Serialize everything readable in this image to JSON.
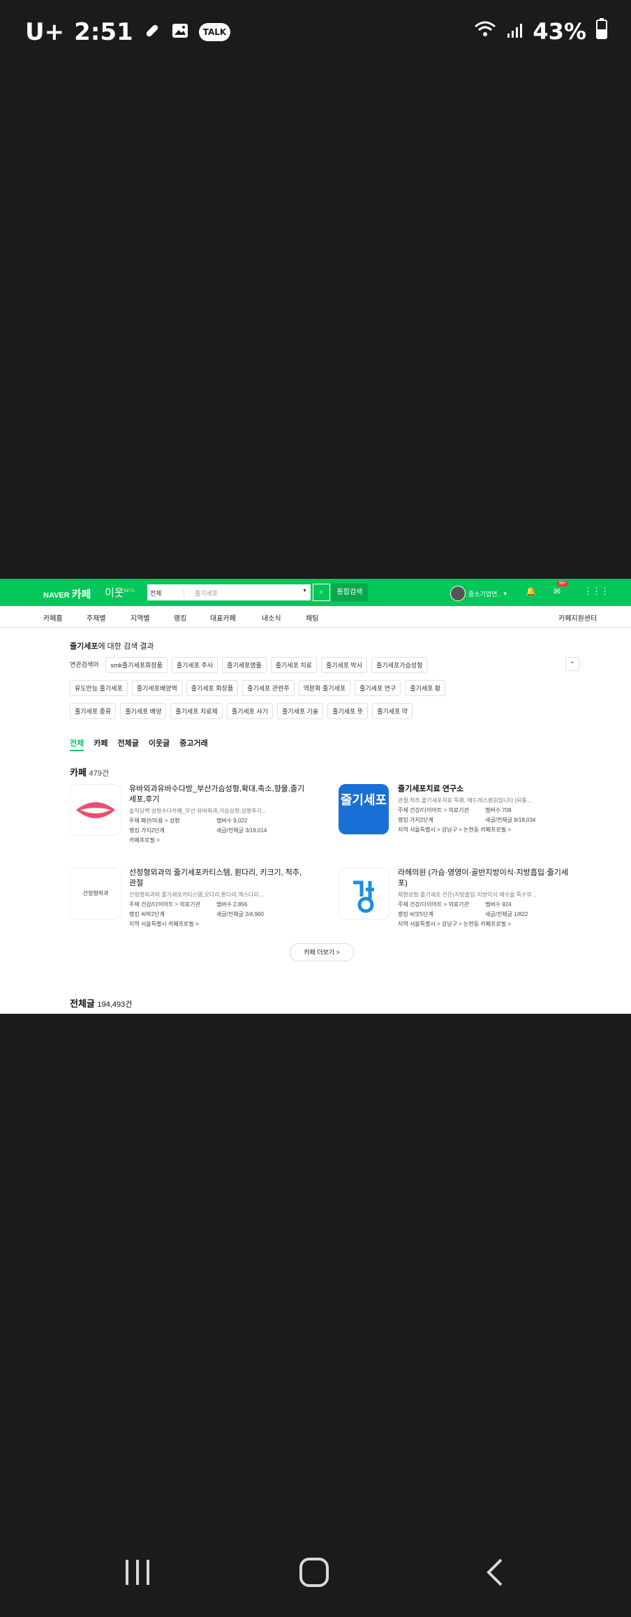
{
  "statusbar": {
    "carrier": "U+",
    "time": "2:51",
    "talk_label": "TALK",
    "battery": "43%"
  },
  "header": {
    "logo_naver": "NAVER",
    "logo_cafe": "카페",
    "iwot": "이웃",
    "iwot_beta": "BETA",
    "search_scope": "전체",
    "search_query": "줄기세포",
    "search_btn": "통합검색",
    "user_name": "중소기업연..",
    "mail_badge": "99+"
  },
  "nav": {
    "items": [
      "카페홈",
      "주제별",
      "지역별",
      "랭킹",
      "대표카페",
      "내소식",
      "채팅"
    ],
    "help": "카페지원센터"
  },
  "results": {
    "keyword": "줄기세포",
    "title_suffix": "에 대한 검색 결과",
    "related_label": "연관검색어",
    "related": [
      "smk줄기세포회장품",
      "줄기세포 주사",
      "줄기세포앰플",
      "줄기세포 치료",
      "줄기세포 박사",
      "줄기세포가슴성형",
      "유도만능 줄기세포",
      "줄기세포배양액",
      "줄기세포 화장품",
      "줄기세포 관련주",
      "역분화 줄기세포",
      "줄기세포 연구",
      "줄기세포 황",
      "줄기세포 종류",
      "줄기세포 배양",
      "줄기세포 치료제",
      "줄기세포 사기",
      "줄기세포 기술",
      "줄기세포 뜻",
      "줄기세포 약"
    ]
  },
  "tabs": [
    "전체",
    "카페",
    "전체글",
    "이웃글",
    "중고거래"
  ],
  "cafe_section": {
    "title": "카페",
    "count": "479건",
    "more": "카페 더보기 >"
  },
  "cafes": [
    {
      "name": "유바외과유바수다방_부산가슴성형,확대,축소,향물,줄기세포,후기",
      "desc": "솔직담백 성형수다카페_부산 유바외과,가슴성형,성형후기...",
      "topic": "주제 패션/미용 > 성형",
      "members": "멤버수 9,022",
      "rank": "랭킹 가지2단계",
      "posts": "새글/전체글 3/19,014",
      "extra": "카페프로필 >"
    },
    {
      "name": "줄기세포치료 연구소",
      "desc": "관절,척추,줄기세포치료 특화, 에드레스병원입니다 [뒤통...",
      "topic": "주제 건강/다이어트 > 의료기관",
      "members": "멤버수 708",
      "rank": "랭킹 가지2단계",
      "posts": "새글/전체글 8/18,034",
      "extra": "지역 서울특별시 > 강남구 > 논현동 카페프로필 >"
    },
    {
      "name": "선정형외과의 줄기세포카티스템, 휜다리, 키크기, 척추, 관절",
      "desc": "선정형외과의 줄기세포카티스템,오다리,휜다리,엑스다리...",
      "topic": "주제 건강/다이어트 > 의료기관",
      "members": "멤버수 2,856",
      "rank": "랭킹 씨박2단계",
      "posts": "새글/전체글 2/4,960",
      "extra": "지역 서울특별시 카페프로필 >"
    },
    {
      "name": "라헤의원 (가슴·영영이·골반지방이식·지방흡입·줄기세포)",
      "desc": "체형성형·줄기세포 전문(지방흡입·지방이식·재수술 특수부...",
      "topic": "주제 건강/다이어트 > 의료기관",
      "members": "멤버수 924",
      "rank": "랭킹 씨앗5단계",
      "posts": "새글/전체글 1/822",
      "extra": "지역 서울특별시 > 강남구 > 논현동 카페프로필 >"
    }
  ],
  "thumbs": {
    "t2": "줄기세포",
    "t3": "선정형외과"
  },
  "all_section": {
    "title": "전체글",
    "count": "194,493건"
  }
}
